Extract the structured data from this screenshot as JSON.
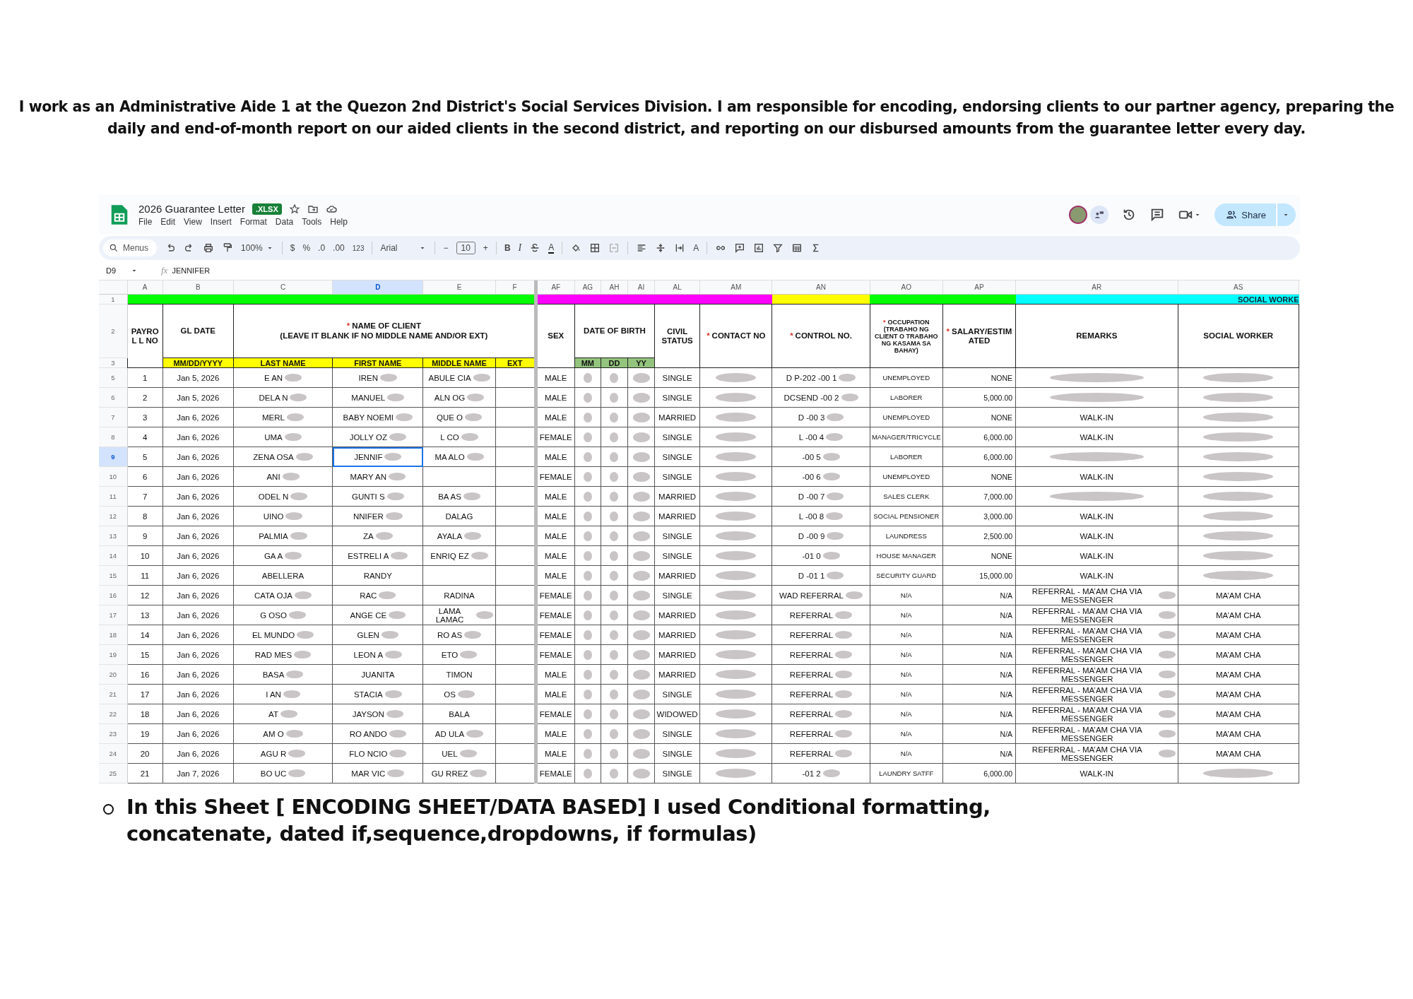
{
  "intro": "I work as an Administrative Aide 1 at the Quezon 2nd District's Social Services Division. I am responsible for encoding, endorsing clients to our partner agency, preparing the daily and end-of-month report on our aided clients in the second district, and reporting on our disbursed amounts from the guarantee letter every day.",
  "app": {
    "title": "2026 Guarantee Letter",
    "badge": ".XLSX",
    "menu": [
      "File",
      "Edit",
      "View",
      "Insert",
      "Format",
      "Data",
      "Tools",
      "Help"
    ],
    "share": "Share"
  },
  "toolbar": {
    "search": "Menus",
    "zoom": "100%",
    "currency": "$",
    "percent": "%",
    "decrease_decimal": ".0",
    "increase_decimal": ".00",
    "number_format": "123",
    "font": "Arial",
    "minus": "−",
    "font_size": "10",
    "plus": "+",
    "bold": "B",
    "italic": "I",
    "text_color": "A",
    "rotate": "A"
  },
  "formula_bar": {
    "cell": "D9",
    "fx": "fx",
    "value": "JENNIFER"
  },
  "band_row": "1",
  "header_rows": [
    "2",
    "3"
  ],
  "header_groups": [
    {
      "label": "PAYROL L NO",
      "columns": [
        {
          "letter": "A",
          "selected": false,
          "color": "#00ff00"
        }
      ]
    },
    {
      "label": "GL DATE",
      "columns": [
        {
          "letter": "B",
          "selected": false,
          "color": "#00ff00",
          "sub": {
            "label": "MM/DD/YYYY",
            "color": "#ffff00"
          }
        }
      ]
    },
    {
      "mark": "*",
      "label": "NAME OF CLIENT",
      "note": "(LEAVE IT BLANK IF NO MIDDLE NAME AND/OR EXT)",
      "columns": [
        {
          "letter": "C",
          "selected": false,
          "color": "#00ff00",
          "sub": {
            "label": "LAST NAME",
            "color": "#ffff00"
          }
        },
        {
          "letter": "D",
          "selected": true,
          "color": "#00ff00",
          "sub": {
            "label": "FIRST NAME",
            "color": "#ffff00"
          }
        },
        {
          "letter": "E",
          "selected": false,
          "color": "#00ff00",
          "sub": {
            "label": "MIDDLE NAME",
            "color": "#ffff00"
          }
        },
        {
          "letter": "F",
          "selected": false,
          "color": "#00ff00",
          "sub": {
            "label": "EXT",
            "color": "#ffff00"
          }
        }
      ]
    },
    {
      "label": "SEX",
      "columns": [
        {
          "letter": "AF",
          "selected": false,
          "color": "#ff00ff"
        }
      ]
    },
    {
      "label": "DATE OF BIRTH",
      "columns": [
        {
          "letter": "AG",
          "selected": false,
          "color": "#ff00ff",
          "sub": {
            "label": "MM",
            "color": "#93c47d"
          }
        },
        {
          "letter": "AH",
          "selected": false,
          "color": "#ff00ff",
          "sub": {
            "label": "DD",
            "color": "#93c47d"
          }
        },
        {
          "letter": "AI",
          "selected": false,
          "color": "#ff00ff",
          "sub": {
            "label": "YY",
            "color": "#93c47d"
          }
        }
      ]
    },
    {
      "label": "CIVIL STATUS",
      "columns": [
        {
          "letter": "AL",
          "selected": false,
          "color": "#ff00ff"
        }
      ]
    },
    {
      "mark": "*",
      "label": "CONTACT NO",
      "columns": [
        {
          "letter": "AM",
          "selected": false,
          "color": "#ff00ff"
        }
      ]
    },
    {
      "mark": "*",
      "label": "CONTROL NO.",
      "columns": [
        {
          "letter": "AN",
          "selected": false,
          "color": "#ffff00"
        }
      ]
    },
    {
      "mark": "*",
      "label": "OCCUPATION (TRABAHO NG CLIENT O TRABAHO NG KASAMA SA BAHAY)",
      "columns": [
        {
          "letter": "AO",
          "selected": false,
          "color": "#00ff00"
        }
      ]
    },
    {
      "mark": "*",
      "label": "SALARY/ESTIMATED",
      "columns": [
        {
          "letter": "AP",
          "selected": false,
          "color": "#00ff00"
        }
      ]
    },
    {
      "label": "REMARKS",
      "columns": [
        {
          "letter": "AR",
          "selected": false,
          "color": "#00ffff"
        }
      ]
    },
    {
      "label": "SOCIAL WORKER",
      "columns": [
        {
          "letter": "AS",
          "selected": false,
          "color": "#00ffff",
          "band_text": "SOCIAL WORKE"
        }
      ]
    }
  ],
  "rows": [
    {
      "row": "5",
      "selected": false,
      "cells": [
        "1",
        "Jan 5, 2026",
        {
          "text": "E AN",
          "redacted": true
        },
        {
          "text": "IREN",
          "redacted": true
        },
        {
          "text": "ABULE CIA",
          "redacted": true
        },
        null,
        "MALE",
        {
          "redacted": true
        },
        {
          "redacted": true
        },
        {
          "redacted": true
        },
        "SINGLE",
        {
          "redacted": true
        },
        {
          "text": "D P-202 -00 1",
          "redacted": true
        },
        "UNEMPLOYED",
        "NONE",
        {
          "redacted": true
        },
        {
          "redacted": true
        }
      ]
    },
    {
      "row": "6",
      "selected": false,
      "cells": [
        "2",
        "Jan 5, 2026",
        {
          "text": "DELA N",
          "redacted": true
        },
        {
          "text": "MANUEL",
          "redacted": true
        },
        {
          "text": "ALN OG",
          "redacted": true
        },
        null,
        "MALE",
        {
          "redacted": true
        },
        {
          "redacted": true
        },
        {
          "redacted": true
        },
        "SINGLE",
        {
          "redacted": true
        },
        {
          "text": "DCSEND -00 2",
          "redacted": true
        },
        "LABORER",
        "5,000.00",
        {
          "redacted": true
        },
        {
          "redacted": true
        }
      ]
    },
    {
      "row": "7",
      "selected": false,
      "cells": [
        "3",
        "Jan 6, 2026",
        {
          "text": "MERL",
          "redacted": true
        },
        {
          "text": "BABY NOEMI",
          "redacted": true
        },
        {
          "text": "QUE O",
          "redacted": true
        },
        null,
        "MALE",
        {
          "redacted": true
        },
        {
          "redacted": true
        },
        {
          "redacted": true
        },
        "MARRIED",
        {
          "redacted": true
        },
        {
          "text": "D -00 3",
          "redacted": true
        },
        "UNEMPLOYED",
        "NONE",
        "WALK-IN",
        {
          "redacted": true
        }
      ]
    },
    {
      "row": "8",
      "selected": false,
      "cells": [
        "4",
        "Jan 6, 2026",
        {
          "text": "UMA",
          "redacted": true
        },
        {
          "text": "JOLLY OZ",
          "redacted": true
        },
        {
          "text": "L CO",
          "redacted": true
        },
        null,
        "FEMALE",
        {
          "redacted": true
        },
        {
          "redacted": true
        },
        {
          "redacted": true
        },
        "SINGLE",
        {
          "redacted": true
        },
        {
          "text": "L -00 4",
          "redacted": true
        },
        "MANAGER/TRICYCLE",
        "6,000.00",
        "WALK-IN",
        {
          "redacted": true
        }
      ]
    },
    {
      "row": "9",
      "selected": true,
      "cells": [
        "5",
        "Jan 6, 2026",
        {
          "text": "ZENA OSA",
          "redacted": true
        },
        {
          "text": "JENNIF",
          "redacted": true
        },
        {
          "text": "MA ALO",
          "redacted": true
        },
        null,
        "MALE",
        {
          "redacted": true
        },
        {
          "redacted": true
        },
        {
          "redacted": true
        },
        "SINGLE",
        {
          "redacted": true
        },
        {
          "text": "-00 5",
          "redacted": true
        },
        "LABORER",
        "6,000.00",
        {
          "redacted": true
        },
        {
          "redacted": true
        }
      ]
    },
    {
      "row": "10",
      "selected": false,
      "cells": [
        "6",
        "Jan 6, 2026",
        {
          "text": "ANI",
          "redacted": true
        },
        {
          "text": "MARY AN",
          "redacted": true
        },
        null,
        null,
        "FEMALE",
        {
          "redacted": true
        },
        {
          "redacted": true
        },
        {
          "redacted": true
        },
        "SINGLE",
        {
          "redacted": true
        },
        {
          "text": "-00 6",
          "redacted": true
        },
        "UNEMPLOYED",
        "NONE",
        "WALK-IN",
        {
          "redacted": true
        }
      ]
    },
    {
      "row": "11",
      "selected": false,
      "cells": [
        "7",
        "Jan 6, 2026",
        {
          "text": "ODEL N",
          "redacted": true
        },
        {
          "text": "GUNTI S",
          "redacted": true
        },
        {
          "text": "BA AS",
          "redacted": true
        },
        null,
        "MALE",
        {
          "redacted": true
        },
        {
          "redacted": true
        },
        {
          "redacted": true
        },
        "MARRIED",
        {
          "redacted": true
        },
        {
          "text": "D -00 7",
          "redacted": true
        },
        "SALES CLERK",
        "7,000.00",
        {
          "redacted": true
        },
        {
          "redacted": true
        }
      ]
    },
    {
      "row": "12",
      "selected": false,
      "cells": [
        "8",
        "Jan 6, 2026",
        {
          "text": "UINO",
          "redacted": true
        },
        {
          "text": "NNIFER",
          "redacted": true
        },
        "DALAG",
        null,
        "MALE",
        {
          "redacted": true
        },
        {
          "redacted": true
        },
        {
          "redacted": true
        },
        "MARRIED",
        {
          "redacted": true
        },
        {
          "text": "L -00 8",
          "redacted": true
        },
        "SOCIAL PENSIONER",
        "3,000.00",
        "WALK-IN",
        {
          "redacted": true
        }
      ]
    },
    {
      "row": "13",
      "selected": false,
      "cells": [
        "9",
        "Jan 6, 2026",
        {
          "text": "PALMIA",
          "redacted": true
        },
        {
          "text": "ZA",
          "redacted": true
        },
        {
          "text": "AYALA",
          "redacted": true
        },
        null,
        "MALE",
        {
          "redacted": true
        },
        {
          "redacted": true
        },
        {
          "redacted": true
        },
        "SINGLE",
        {
          "redacted": true
        },
        {
          "text": "D -00 9",
          "redacted": true
        },
        "LAUNDRESS",
        "2,500.00",
        "WALK-IN",
        {
          "redacted": true
        }
      ]
    },
    {
      "row": "14",
      "selected": false,
      "cells": [
        "10",
        "Jan 6, 2026",
        {
          "text": "GA A",
          "redacted": true
        },
        {
          "text": "ESTRELI A",
          "redacted": true
        },
        {
          "text": "ENRIQ EZ",
          "redacted": true
        },
        null,
        "MALE",
        {
          "redacted": true
        },
        {
          "redacted": true
        },
        {
          "redacted": true
        },
        "SINGLE",
        {
          "redacted": true
        },
        {
          "text": "-01 0",
          "redacted": true
        },
        "HOUSE MANAGER",
        "NONE",
        "WALK-IN",
        {
          "redacted": true
        }
      ]
    },
    {
      "row": "15",
      "selected": false,
      "cells": [
        "11",
        "Jan 6, 2026",
        "ABELLERA",
        "RANDY",
        null,
        null,
        "MALE",
        {
          "redacted": true
        },
        {
          "redacted": true
        },
        {
          "redacted": true
        },
        "MARRIED",
        {
          "redacted": true
        },
        {
          "text": "D -01 1",
          "redacted": true
        },
        "SECURITY GUARD",
        "15,000.00",
        "WALK-IN",
        {
          "redacted": true
        }
      ]
    },
    {
      "row": "16",
      "selected": false,
      "cells": [
        "12",
        "Jan 6, 2026",
        {
          "text": "CATA OJA",
          "redacted": true
        },
        {
          "text": "RAC",
          "redacted": true
        },
        "RADINA",
        null,
        "FEMALE",
        {
          "redacted": true
        },
        {
          "redacted": true
        },
        {
          "redacted": true
        },
        "SINGLE",
        {
          "redacted": true
        },
        {
          "text": "WAD REFERRAL",
          "redacted": true
        },
        "N/A",
        "N/A",
        {
          "text": "REFERRAL - MA’AM CHA VIA MESSENGER",
          "redacted": true
        },
        "MA’AM CHA"
      ]
    },
    {
      "row": "17",
      "selected": false,
      "cells": [
        "13",
        "Jan 6, 2026",
        {
          "text": "G OSO",
          "redacted": true
        },
        {
          "text": "ANGE CE",
          "redacted": true
        },
        {
          "text": "LAMA LAMAC",
          "redacted": true
        },
        null,
        "FEMALE",
        {
          "redacted": true
        },
        {
          "redacted": true
        },
        {
          "redacted": true
        },
        "MARRIED",
        {
          "redacted": true
        },
        {
          "text": "REFERRAL",
          "redacted": true
        },
        "N/A",
        "N/A",
        {
          "text": "REFERRAL - MA’AM CHA VIA MESSENGER",
          "redacted": true
        },
        "MA’AM CHA"
      ]
    },
    {
      "row": "18",
      "selected": false,
      "cells": [
        "14",
        "Jan 6, 2026",
        {
          "text": "EL MUNDO",
          "redacted": true
        },
        {
          "text": "GLEN",
          "redacted": true
        },
        {
          "text": "RO AS",
          "redacted": true
        },
        null,
        "FEMALE",
        {
          "redacted": true
        },
        {
          "redacted": true
        },
        {
          "redacted": true
        },
        "MARRIED",
        {
          "redacted": true
        },
        {
          "text": "REFERRAL",
          "redacted": true
        },
        "N/A",
        "N/A",
        {
          "text": "REFERRAL - MA’AM CHA VIA MESSENGER",
          "redacted": true
        },
        "MA’AM CHA"
      ]
    },
    {
      "row": "19",
      "selected": false,
      "cells": [
        "15",
        "Jan 6, 2026",
        {
          "text": "RAD MES",
          "redacted": true
        },
        {
          "text": "LEON A",
          "redacted": true
        },
        {
          "text": "ETO",
          "redacted": true
        },
        null,
        "FEMALE",
        {
          "redacted": true
        },
        {
          "redacted": true
        },
        {
          "redacted": true
        },
        "MARRIED",
        {
          "redacted": true
        },
        {
          "text": "REFERRAL",
          "redacted": true
        },
        "N/A",
        "N/A",
        {
          "text": "REFERRAL - MA’AM CHA VIA MESSENGER",
          "redacted": true
        },
        "MA’AM CHA"
      ]
    },
    {
      "row": "20",
      "selected": false,
      "cells": [
        "16",
        "Jan 6, 2026",
        {
          "text": "BASA",
          "redacted": true
        },
        "JUANITA",
        "TIMON",
        null,
        "MALE",
        {
          "redacted": true
        },
        {
          "redacted": true
        },
        {
          "redacted": true
        },
        "MARRIED",
        {
          "redacted": true
        },
        {
          "text": "REFERRAL",
          "redacted": true
        },
        "N/A",
        "N/A",
        {
          "text": "REFERRAL - MA’AM CHA VIA MESSENGER",
          "redacted": true
        },
        "MA’AM CHA"
      ]
    },
    {
      "row": "21",
      "selected": false,
      "cells": [
        "17",
        "Jan 6, 2026",
        {
          "text": "I AN",
          "redacted": true
        },
        {
          "text": "STACIA",
          "redacted": true
        },
        {
          "text": "OS",
          "redacted": true
        },
        null,
        "MALE",
        {
          "redacted": true
        },
        {
          "redacted": true
        },
        {
          "redacted": true
        },
        "SINGLE",
        {
          "redacted": true
        },
        {
          "text": "REFERRAL",
          "redacted": true
        },
        "N/A",
        "N/A",
        {
          "text": "REFERRAL - MA’AM CHA VIA MESSENGER",
          "redacted": true
        },
        "MA’AM CHA"
      ]
    },
    {
      "row": "22",
      "selected": false,
      "cells": [
        "18",
        "Jan 6, 2026",
        {
          "text": "AT",
          "redacted": true
        },
        {
          "text": "JAYSON",
          "redacted": true
        },
        "BALA",
        null,
        "FEMALE",
        {
          "redacted": true
        },
        {
          "redacted": true
        },
        {
          "redacted": true
        },
        "WIDOWED",
        {
          "redacted": true
        },
        {
          "text": "REFERRAL",
          "redacted": true
        },
        "N/A",
        "N/A",
        {
          "text": "REFERRAL - MA’AM CHA VIA MESSENGER",
          "redacted": true
        },
        "MA’AM CHA"
      ]
    },
    {
      "row": "23",
      "selected": false,
      "cells": [
        "19",
        "Jan 6, 2026",
        {
          "text": "AM O",
          "redacted": true
        },
        {
          "text": "RO ANDO",
          "redacted": true
        },
        {
          "text": "AD ULA",
          "redacted": true
        },
        null,
        "MALE",
        {
          "redacted": true
        },
        {
          "redacted": true
        },
        {
          "redacted": true
        },
        "SINGLE",
        {
          "redacted": true
        },
        {
          "text": "REFERRAL",
          "redacted": true
        },
        "N/A",
        "N/A",
        {
          "text": "REFERRAL - MA’AM CHA VIA MESSENGER",
          "redacted": true
        },
        "MA’AM CHA"
      ]
    },
    {
      "row": "24",
      "selected": false,
      "cells": [
        "20",
        "Jan 6, 2026",
        {
          "text": "AGU R",
          "redacted": true
        },
        {
          "text": "FLO NCIO",
          "redacted": true
        },
        {
          "text": "UEL",
          "redacted": true
        },
        null,
        "MALE",
        {
          "redacted": true
        },
        {
          "redacted": true
        },
        {
          "redacted": true
        },
        "SINGLE",
        {
          "redacted": true
        },
        {
          "text": "REFERRAL",
          "redacted": true
        },
        "N/A",
        "N/A",
        {
          "text": "REFERRAL - MA’AM CHA VIA MESSENGER",
          "redacted": true
        },
        "MA’AM CHA"
      ]
    },
    {
      "row": "25",
      "selected": false,
      "cells": [
        "21",
        "Jan 7, 2026",
        {
          "text": "BO UC",
          "redacted": true
        },
        {
          "text": "MAR VIC",
          "redacted": true
        },
        {
          "text": "GU RREZ",
          "redacted": true
        },
        null,
        "FEMALE",
        {
          "redacted": true
        },
        {
          "redacted": true
        },
        {
          "redacted": true
        },
        "SINGLE",
        {
          "redacted": true
        },
        {
          "text": "-01 2",
          "redacted": true
        },
        "LAUNDRY SATFF",
        "6,000.00",
        "WALK-IN",
        {
          "redacted": true
        }
      ]
    }
  ],
  "note": "In this Sheet [ ENCODING SHEET/DATA BASED] I used Conditional formatting, concatenate, dated if,sequence,dropdowns, if formulas)"
}
